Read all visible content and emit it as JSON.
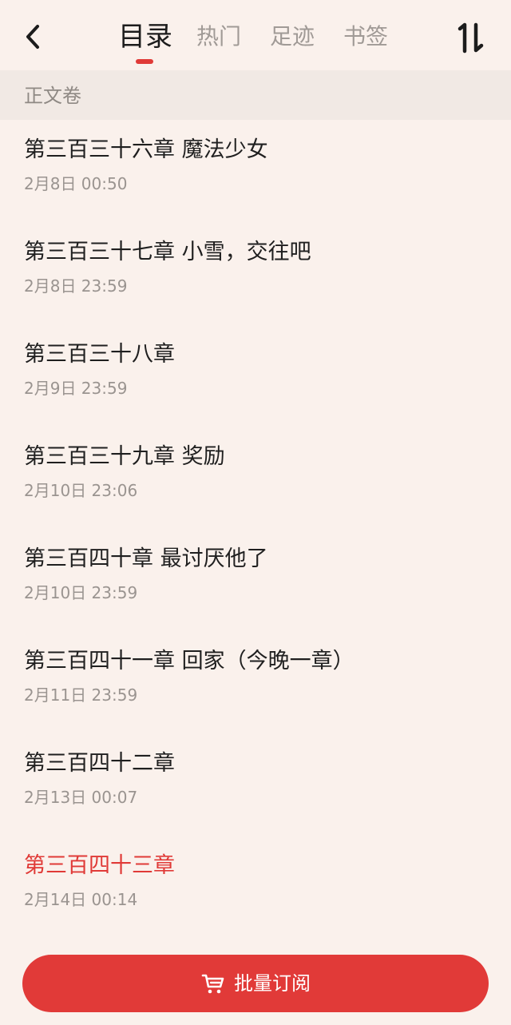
{
  "header": {
    "back_icon": "chevron-left-icon",
    "tabs": [
      {
        "label": "目录",
        "active": true
      },
      {
        "label": "热门",
        "active": false
      },
      {
        "label": "足迹",
        "active": false
      },
      {
        "label": "书签",
        "active": false
      }
    ],
    "sort_icon": "sort-order-icon"
  },
  "volume": {
    "label": "正文卷"
  },
  "chapters": [
    {
      "title": "第三百三十六章 魔法少女",
      "date": "2月8日 00:50"
    },
    {
      "title": "第三百三十七章 小雪，交往吧",
      "date": "2月8日 23:59"
    },
    {
      "title": "第三百三十八章",
      "date": "2月9日 23:59"
    },
    {
      "title": "第三百三十九章 奖励",
      "date": "2月10日 23:06"
    },
    {
      "title": "第三百四十章 最讨厌他了",
      "date": "2月10日 23:59"
    },
    {
      "title": "第三百四十一章 回家（今晚一章）",
      "date": "2月11日 23:59"
    },
    {
      "title": "第三百四十二章",
      "date": "2月13日 00:07"
    },
    {
      "title": "第三百四十三章",
      "date": "2月14日 00:14",
      "current": true
    }
  ],
  "footer": {
    "subscribe_label": "批量订阅",
    "cart_icon": "shopping-cart-icon"
  },
  "colors": {
    "background": "#faf1ec",
    "accent": "#e03a37",
    "section_bg": "#f1e9e4"
  }
}
